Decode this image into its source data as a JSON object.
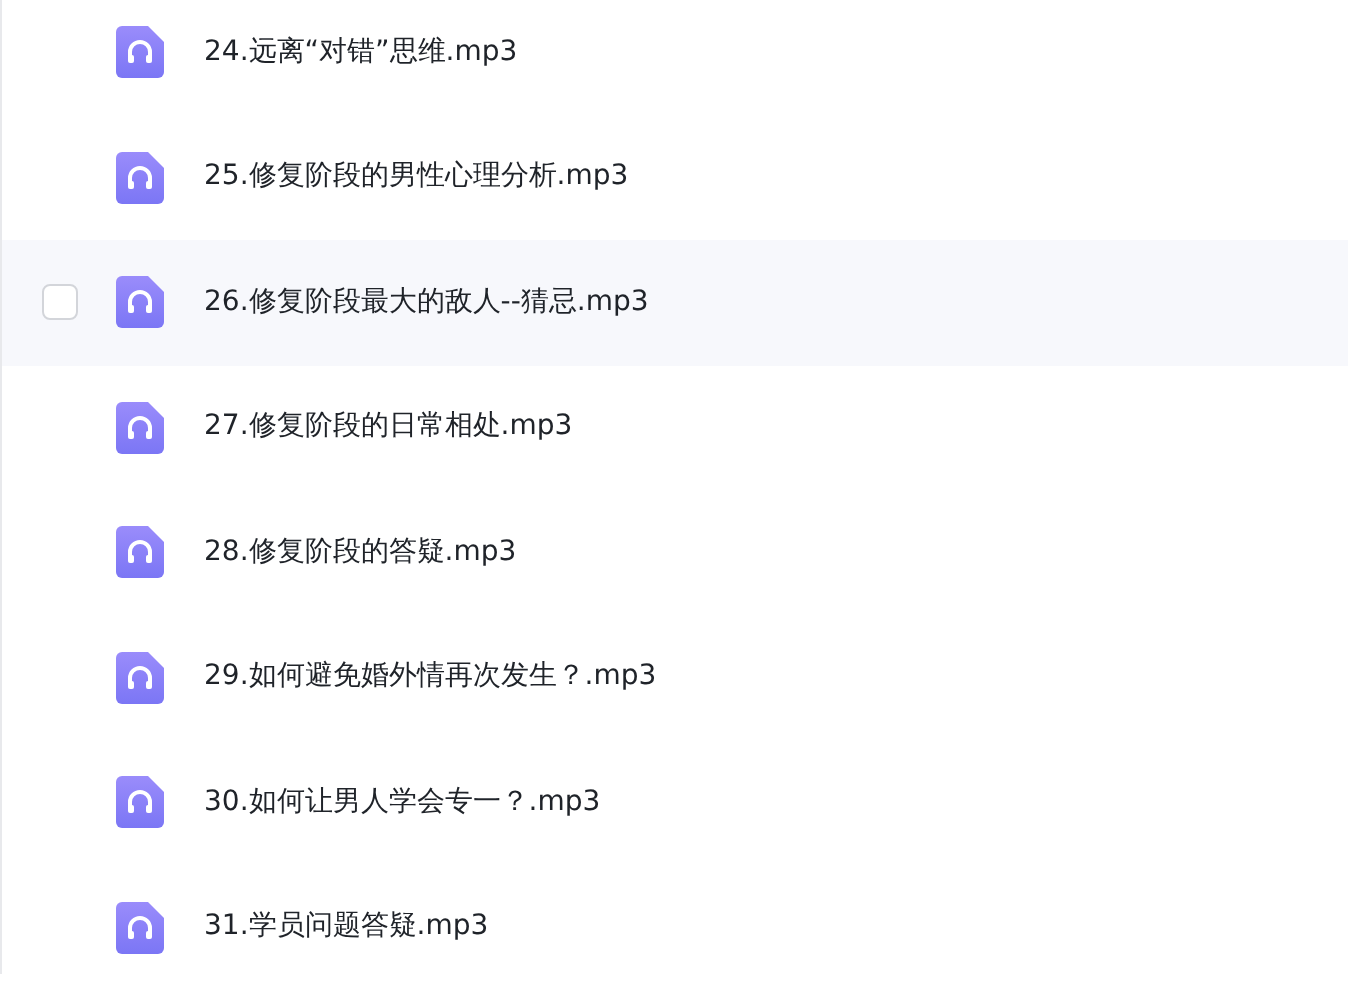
{
  "files": [
    {
      "name": "24.远离“对错”思维.mp3",
      "hovered": false
    },
    {
      "name": "25.修复阶段的男性心理分析.mp3",
      "hovered": false
    },
    {
      "name": "26.修复阶段最大的敌人--猜忌.mp3",
      "hovered": true
    },
    {
      "name": "27.修复阶段的日常相处.mp3",
      "hovered": false
    },
    {
      "name": "28.修复阶段的答疑.mp3",
      "hovered": false
    },
    {
      "name": "29.如何避免婚外情再次发生？.mp3",
      "hovered": false
    },
    {
      "name": "30.如何让男人学会专一？.mp3",
      "hovered": false
    },
    {
      "name": "31.学员问题答疑.mp3",
      "hovered": false
    }
  ]
}
